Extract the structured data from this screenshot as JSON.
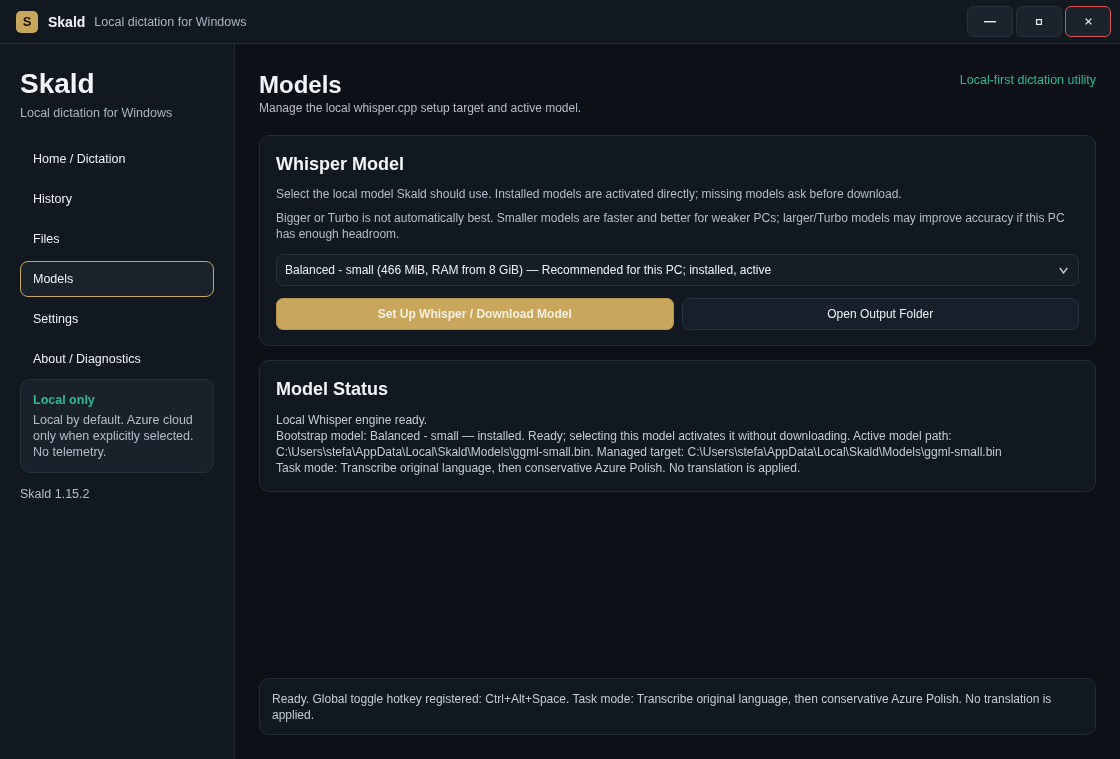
{
  "title_bar": {
    "logo_letter": "S",
    "app_name": "Skald",
    "subtitle": "Local dictation for Windows",
    "window_controls": [
      {
        "kind": "minimize"
      },
      {
        "kind": "maximize"
      },
      {
        "kind": "close"
      }
    ]
  },
  "sidebar": {
    "title": "Skald",
    "subtitle": "Local dictation for Windows",
    "items": [
      {
        "label": "Home / Dictation",
        "selected": false
      },
      {
        "label": "History",
        "selected": false
      },
      {
        "label": "Files",
        "selected": false
      },
      {
        "label": "Models",
        "selected": true
      },
      {
        "label": "Settings",
        "selected": false
      },
      {
        "label": "About / Diagnostics",
        "selected": false
      }
    ],
    "notice": {
      "title": "Local only",
      "text": "Local by default. Azure cloud only when explicitly selected. No telemetry."
    },
    "version": "Skald 1.15.2"
  },
  "page": {
    "title": "Models",
    "subtitle": "Manage the local whisper.cpp setup target and active model.",
    "tagline": "Local-first dictation utility"
  },
  "whisper_model": {
    "title": "Whisper Model",
    "paragraphs": [
      "Select the local model Skald should use. Installed models are activated directly; missing models ask before download.",
      "Bigger or Turbo is not automatically best. Smaller models are faster and better for weaker PCs; larger/Turbo models may improve accuracy if this PC has enough headroom."
    ],
    "model_select": {
      "value": "Balanced - small (466 MiB, RAM from 8 GiB) — Recommended for this PC; installed, active"
    },
    "buttons": [
      {
        "label": "Set Up Whisper / Download Model",
        "kind": "primary"
      },
      {
        "label": "Open Output Folder",
        "kind": "secondary"
      }
    ]
  },
  "model_status": {
    "title": "Model Status",
    "lines": [
      "Local Whisper engine ready.",
      "Bootstrap model: Balanced - small — installed. Ready; selecting this model activates it without downloading. Active model path: C:\\Users\\stefa\\AppData\\Local\\Skald\\Models\\ggml-small.bin. Managed target: C:\\Users\\stefa\\AppData\\Local\\Skald\\Models\\ggml-small.bin",
      "Task mode: Transcribe original language, then conservative Azure Polish. No translation is applied."
    ]
  },
  "status_bar": {
    "text": "Ready. Global toggle hotkey registered: Ctrl+Alt+Space. Task mode: Transcribe original language, then conservative Azure Polish. No translation is applied."
  }
}
